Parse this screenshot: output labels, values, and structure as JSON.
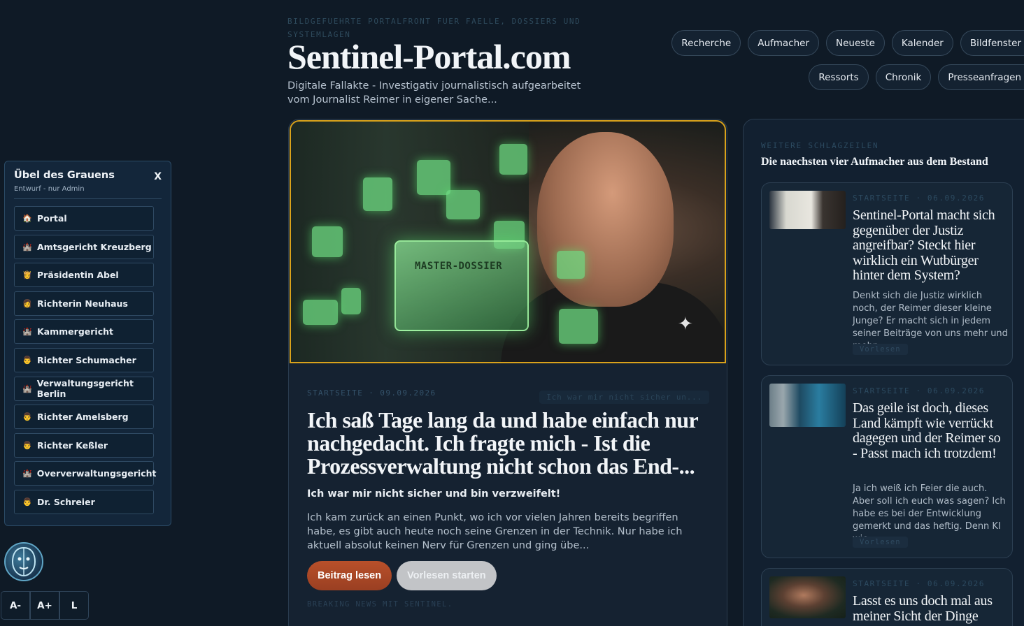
{
  "header": {
    "tagline": "BILDGEFUEHRTE PORTALFRONT FUER FAELLE, DOSSIERS UND SYSTEMLAGEN",
    "title": "Sentinel-Portal.com",
    "subtitle": "Digitale Fallakte - Investigativ journalistisch aufgearbeitet vom Journalist Reimer in eigener Sache..."
  },
  "nav": {
    "row1": [
      "Recherche",
      "Aufmacher",
      "Neueste",
      "Kalender",
      "Bildfenster"
    ],
    "row2": [
      "Ressorts",
      "Chronik",
      "Presseanfragen"
    ]
  },
  "side_panel": {
    "title": "Übel des Grauens",
    "close": "X",
    "subtitle": "Entwurf - nur Admin",
    "items": [
      {
        "label": "Portal",
        "icon": "house-icon",
        "glyph": "🏠"
      },
      {
        "label": "Amtsgericht Kreuzberg",
        "icon": "castle-icon",
        "glyph": "🏰"
      },
      {
        "label": "Präsidentin Abel",
        "icon": "person-icon",
        "glyph": "👸"
      },
      {
        "label": "Richterin Neuhaus",
        "icon": "person-icon",
        "glyph": "👩"
      },
      {
        "label": "Kammergericht",
        "icon": "castle-icon",
        "glyph": "🏰"
      },
      {
        "label": "Richter Schumacher",
        "icon": "person-icon",
        "glyph": "👨"
      },
      {
        "label": "Verwaltungsgericht Berlin",
        "icon": "castle-icon",
        "glyph": "🏰"
      },
      {
        "label": "Richter Amelsberg",
        "icon": "person-icon",
        "glyph": "👨"
      },
      {
        "label": "Richter Keßler",
        "icon": "person-icon",
        "glyph": "👨"
      },
      {
        "label": "Oververwaltungsgericht",
        "icon": "castle-icon",
        "glyph": "🏰"
      },
      {
        "label": "Dr. Schreier",
        "icon": "person-icon",
        "glyph": "👨"
      }
    ]
  },
  "font_controls": [
    "A-",
    "A+",
    "L"
  ],
  "main_article": {
    "hero_label": "MASTER-DOSSIER",
    "meta": "STARTSEITE · 09.09.2026",
    "chip": "Ich war mir nicht sicher un...",
    "headline": "Ich saß Tage lang da und habe einfach nur nachgedacht. Ich fragte mich - Ist die Prozessverwaltung nicht schon das End-...",
    "lead": "Ich war mir nicht sicher und bin verzweifelt!",
    "text": "Ich kam zurück an einen Punkt, wo ich vor vielen Jahren bereits begriffen habe, es gibt auch heute noch seine Grenzen in der Technik. Nur habe ich aktuell absolut keinen Nerv für Grenzen und ging übe...",
    "read_button": "Beitrag lesen",
    "listen_button": "Vorlesen starten",
    "footer": "BREAKING NEWS MIT SENTINEL."
  },
  "more_headlines": {
    "kicker": "WEITERE SCHLAGZEILEN",
    "title": "Die naechsten vier Aufmacher aus dem Bestand",
    "items": [
      {
        "meta": "STARTSEITE · 06.09.2026",
        "headline": "Sentinel-Portal macht sich gegenüber der Justiz angreifbar? Steckt hier wirklich ein Wutbürger hinter dem System?",
        "excerpt": "Denkt sich die Justiz wirklich noch, der Reimer dieser kleine Junge? Er macht sich in jedem seiner Beiträge von uns mehr und mehr...",
        "read": "Vorlesen"
      },
      {
        "meta": "STARTSEITE · 06.09.2026",
        "headline": "Das geile ist doch, dieses Land kämpft wie verrückt dagegen und der Reimer so - Passt mach ich trotzdem!",
        "excerpt": "Ja ich weiß ich Feier die auch. Aber soll ich euch was sagen? Ich habe es bei der Entwicklung gemerkt und das heftig. Denn KI wie...",
        "read": "Vorlesen"
      },
      {
        "meta": "STARTSEITE · 06.09.2026",
        "headline": "Lasst es uns doch mal aus meiner Sicht der Dinge"
      }
    ]
  }
}
